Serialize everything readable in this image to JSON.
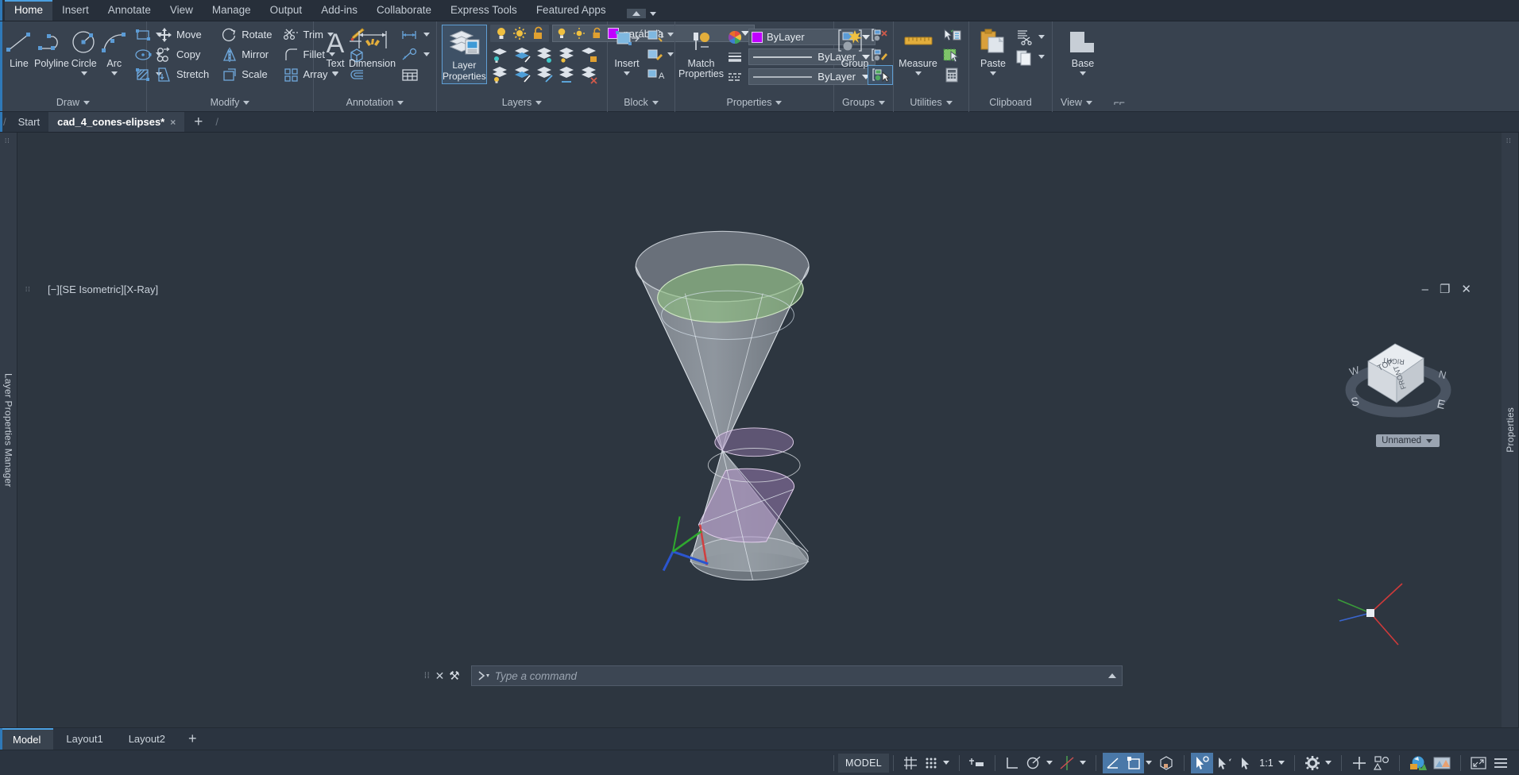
{
  "ribbon": {
    "tabs": [
      {
        "label": "Home",
        "active": true
      },
      {
        "label": "Insert",
        "active": false
      },
      {
        "label": "Annotate",
        "active": false
      },
      {
        "label": "View",
        "active": false
      },
      {
        "label": "Manage",
        "active": false
      },
      {
        "label": "Output",
        "active": false
      },
      {
        "label": "Add-ins",
        "active": false
      },
      {
        "label": "Collaborate",
        "active": false
      },
      {
        "label": "Express Tools",
        "active": false
      },
      {
        "label": "Featured Apps",
        "active": false
      }
    ],
    "panels": {
      "draw": {
        "title": "Draw",
        "buttons": [
          {
            "label": "Line",
            "icon": "line-icon"
          },
          {
            "label": "Polyline",
            "icon": "polyline-icon"
          },
          {
            "label": "Circle",
            "icon": "circle-icon"
          },
          {
            "label": "Arc",
            "icon": "arc-icon"
          }
        ],
        "flyouts": [
          "rectangle-icon",
          "ellipse-icon",
          "hatch-icon"
        ]
      },
      "modify": {
        "title": "Modify",
        "buttons": [
          {
            "label": "Move",
            "icon": "move-icon"
          },
          {
            "label": "Rotate",
            "icon": "rotate-icon"
          },
          {
            "label": "Trim",
            "icon": "trim-icon"
          },
          {
            "label": "Copy",
            "icon": "copy-icon"
          },
          {
            "label": "Mirror",
            "icon": "mirror-icon"
          },
          {
            "label": "Fillet",
            "icon": "fillet-icon"
          },
          {
            "label": "Stretch",
            "icon": "stretch-icon"
          },
          {
            "label": "Scale",
            "icon": "scale-icon"
          },
          {
            "label": "Array",
            "icon": "array-icon"
          }
        ],
        "extras": [
          "match-brush-icon",
          "3d-solid-icon",
          "offset-icon"
        ]
      },
      "annotation": {
        "title": "Annotation",
        "buttons": [
          {
            "label": "Text",
            "icon": "text-icon"
          },
          {
            "label": "Dimension",
            "icon": "dimension-icon"
          }
        ],
        "extras": [
          "linear-dimension-icon",
          "leader-icon",
          "table-icon"
        ]
      },
      "layers": {
        "title": "Layers",
        "main_button": {
          "label": "Layer\nProperties",
          "line1": "Layer",
          "line2": "Properties",
          "icon": "layer-properties-icon",
          "active": true
        },
        "current_layer": "parábola",
        "layer_color": "#c000ff",
        "state_icons": [
          "lightbulb-on-icon",
          "sun-freeze-icon",
          "unlock-icon"
        ]
      },
      "block": {
        "title": "Block",
        "buttons": [
          {
            "label": "Insert",
            "icon": "insert-block-icon"
          }
        ],
        "extras": [
          "create-block-icon",
          "edit-block-icon",
          "block-attributes-icon"
        ]
      },
      "properties": {
        "title": "Properties",
        "rows": [
          {
            "icon": "color-wheel-icon",
            "value": "ByLayer",
            "swatch": "#c000ff",
            "type": "color"
          },
          {
            "icon": "linewidth-icon",
            "value": "ByLayer",
            "type": "lineweight"
          },
          {
            "icon": "linetype-icon",
            "value": "ByLayer",
            "type": "linetype"
          }
        ]
      },
      "groups": {
        "title": "Groups",
        "buttons": [
          {
            "label": "Group",
            "icon": "group-icon"
          }
        ],
        "extras": [
          "ungroup-icon",
          "group-edit-icon",
          "group-selection-icon"
        ]
      },
      "utilities": {
        "title": "Utilities",
        "buttons": [
          {
            "label": "Measure",
            "icon": "measure-icon"
          }
        ],
        "extras": [
          "quick-select-icon",
          "quick-calc-area-icon",
          "calculator-icon"
        ]
      },
      "clipboard": {
        "title": "Clipboard",
        "buttons": [
          {
            "label": "Paste",
            "icon": "paste-icon"
          }
        ],
        "extras": [
          "cut-icon",
          "copy-clip-icon"
        ]
      },
      "view": {
        "title": "View",
        "buttons": [
          {
            "label": "Base",
            "icon": "base-view-icon"
          }
        ]
      }
    }
  },
  "doc_tabs": {
    "start_label": "Start",
    "tabs": [
      {
        "label": "cad_4_cones-elipses*",
        "active": true,
        "close": "×"
      }
    ],
    "add_label": "+"
  },
  "left_panel": {
    "title": "Layer Properties Manager"
  },
  "right_panel": {
    "title": "Properties"
  },
  "viewport": {
    "label": "[−][SE Isometric][X-Ray]",
    "window_controls": [
      "–",
      "❐",
      "✕"
    ],
    "viewcube_faces": {
      "top": "TOP",
      "front": "FRONT",
      "right": "RIGHT"
    },
    "compass": {
      "n": "N",
      "e": "E",
      "s": "S",
      "w": "W"
    },
    "ucs_name": "Unnamed"
  },
  "command_line": {
    "placeholder": "Type a command",
    "close_label": "✕",
    "tools_label": "⚒"
  },
  "layout_tabs": {
    "tabs": [
      {
        "label": "Model",
        "active": true
      },
      {
        "label": "Layout1",
        "active": false
      },
      {
        "label": "Layout2",
        "active": false
      }
    ],
    "add_label": "+"
  },
  "status_bar": {
    "model_label": "MODEL",
    "scale_label": "1:1",
    "items": [
      {
        "name": "grid-display-icon",
        "on": false
      },
      {
        "name": "snap-mode-icon",
        "on": false
      },
      {
        "name": "infer-constraints-icon",
        "on": false
      },
      {
        "name": "ortho-mode-icon",
        "on": false
      },
      {
        "name": "polar-tracking-icon",
        "on": false
      },
      {
        "name": "object-snap-tracking-icon",
        "on": false
      },
      {
        "name": "object-snap-icon",
        "on": true
      },
      {
        "name": "dynamic-ucs-icon",
        "on": true
      },
      {
        "name": "3d-object-snap-icon",
        "on": false
      },
      {
        "name": "selection-cycling-icon",
        "on": true
      },
      {
        "name": "annotation-visibility-icon",
        "on": false
      },
      {
        "name": "autoscale-icon",
        "on": false
      },
      {
        "name": "workspace-switch-icon",
        "on": false
      },
      {
        "name": "add-to-toolbar-icon",
        "on": false
      },
      {
        "name": "isolate-objects-icon",
        "on": false
      },
      {
        "name": "hardware-acceleration-icon",
        "on": false
      },
      {
        "name": "clean-screen-icon",
        "on": false
      },
      {
        "name": "fullscreen-icon",
        "on": false
      },
      {
        "name": "customization-icon",
        "on": false
      }
    ]
  },
  "drawing": {
    "description": "Two cones joined at apex (hourglass) with conic-section ellipses",
    "upper_ellipse_color": "#7fbf6a",
    "lower_ellipse_color": "#b07fc8",
    "outline_color": "#c8ccd2",
    "axis_colors": {
      "x": "#d03030",
      "y": "#30b030",
      "z": "#3050d0"
    }
  }
}
